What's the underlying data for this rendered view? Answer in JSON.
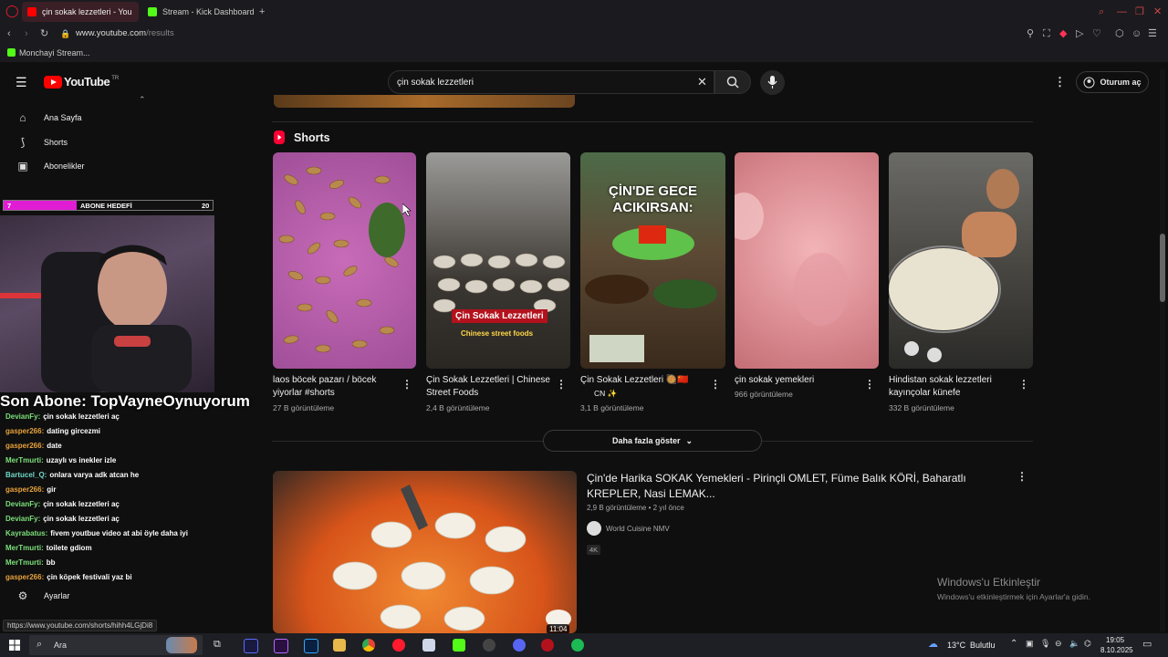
{
  "browser": {
    "tabs": [
      {
        "label": "çin sokak lezzetleri - You",
        "active": true
      },
      {
        "label": "Stream - Kick Dashboard",
        "active": false
      }
    ],
    "url_domain": "www.youtube.com",
    "url_path": "/results",
    "bookmark": "Monchayi Stream..."
  },
  "youtube": {
    "logo_text": "YouTube",
    "logo_region": "TR",
    "search_value": "çin sokak lezzetleri",
    "signin_label": "Oturum aç",
    "sidebar": [
      {
        "label": "Ana Sayfa",
        "icon": "home-icon"
      },
      {
        "label": "Shorts",
        "icon": "shorts-icon"
      },
      {
        "label": "Abonelikler",
        "icon": "subscriptions-icon"
      }
    ],
    "settings_label": "Ayarlar",
    "shorts_heading": "Shorts",
    "shorts": [
      {
        "title": "laos böcek pazarı / böcek yiyorlar #shorts",
        "views": "27 B görüntüleme"
      },
      {
        "title": "Çin Sokak Lezzetleri | Chinese Street Foods",
        "views": "2,4 B görüntüleme",
        "overlay_title": "Çin Sokak Lezzetleri",
        "overlay_sub": "Chinese street foods"
      },
      {
        "title": "Çin Sokak Lezzetleri 🥘🇨🇳",
        "title2": "CN ✨",
        "views": "3,1 B görüntüleme",
        "overlay": "ÇİN'DE GECE ACIKIRSAN:"
      },
      {
        "title": "çin sokak yemekleri",
        "views": "966 görüntüleme"
      },
      {
        "title": "Hindistan sokak lezzetleri kayınçolar künefe",
        "views": "332 B görüntüleme"
      }
    ],
    "show_more": "Daha fazla göster",
    "video": {
      "title": "Çin'de Harika SOKAK Yemekleri - Pirinçli OMLET, Füme Balık KÖRİ, Baharatlı KREPLER, Nasi LEMAK...",
      "meta": "2,9 B görüntüleme • 2 yıl önce",
      "channel": "World Cuisine NMV",
      "badge": "4K",
      "duration": "11:04"
    },
    "status_url": "https://www.youtube.com/shorts/hihh4LGjDi8"
  },
  "overlay": {
    "goal_current": "7",
    "goal_label": "ABONE HEDEFİ",
    "goal_target": "20",
    "goal_fraction": 0.35,
    "last_sub": "Son Abone: TopVayneOynuyorum",
    "chat": [
      {
        "user": "DevianFy:",
        "msg": "çin sokak lezzetleri aç",
        "color": "#7be07b"
      },
      {
        "user": "gasper266:",
        "msg": "dating gircezmi",
        "color": "#e8a23c"
      },
      {
        "user": "gasper266:",
        "msg": "date",
        "color": "#e8a23c"
      },
      {
        "user": "MerTmurti:",
        "msg": "uzaylı vs inekler izle",
        "color": "#7be07b"
      },
      {
        "user": "Bartucel_Q:",
        "msg": "onlara varya adk atcan he",
        "color": "#6fd8c6"
      },
      {
        "user": "gasper266:",
        "msg": "gir",
        "color": "#e8a23c"
      },
      {
        "user": "DevianFy:",
        "msg": "çin sokak lezzetleri aç",
        "color": "#7be07b"
      },
      {
        "user": "DevianFy:",
        "msg": "çin sokak lezzetleri aç",
        "color": "#7be07b"
      },
      {
        "user": "Kayrabatus:",
        "msg": "fivem youtbue video at abi öyle daha iyi",
        "color": "#7be07b"
      },
      {
        "user": "MerTmurti:",
        "msg": "toilete gdiom",
        "color": "#7be07b"
      },
      {
        "user": "MerTmurti:",
        "msg": "bb",
        "color": "#7be07b"
      },
      {
        "user": "gasper266:",
        "msg": "çin köpek festivali yaz bi",
        "color": "#e8a23c"
      }
    ]
  },
  "windows": {
    "activate_title": "Windows'u Etkinleştir",
    "activate_sub": "Windows'u etkinleştirmek için Ayarlar'a gidin.",
    "search_label": "Ara",
    "weather": "13°C",
    "weather_desc": "Bulutlu",
    "time": "19:05",
    "date": "8.10.2025"
  }
}
